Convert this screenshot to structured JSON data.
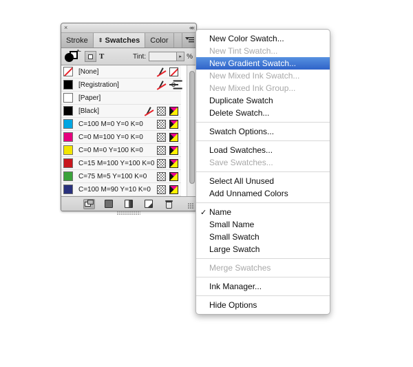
{
  "panel": {
    "close_icon": "×",
    "collapse_icon": "««",
    "tabs": [
      {
        "label": "Stroke",
        "active": false
      },
      {
        "label": "Swatches",
        "active": true
      },
      {
        "label": "Color",
        "active": false
      }
    ],
    "menu_button_icon": "panel-menu-icon",
    "toolbar": {
      "fill_stroke_proxy": "fill-stroke-proxy",
      "formatting_container_icon": "formatting-affects-container-icon",
      "formatting_text_icon": "T",
      "tint_label": "Tint:",
      "tint_value": "",
      "tint_placeholder": "",
      "tint_unit": "%",
      "stepper_icon": "▸"
    },
    "swatches": [
      {
        "name": "[None]",
        "chip": "none",
        "chip_color": "#ffffff",
        "icons": [
          "pen",
          "none-swatch"
        ]
      },
      {
        "name": "[Registration]",
        "chip": "solid",
        "chip_color": "#000000",
        "icons": [
          "pen",
          "registration"
        ]
      },
      {
        "name": "[Paper]",
        "chip": "solid",
        "chip_color": "#ffffff",
        "icons": []
      },
      {
        "name": "[Black]",
        "chip": "solid",
        "chip_color": "#000000",
        "icons": [
          "pen",
          "checkerboard",
          "cmyk"
        ]
      },
      {
        "name": "C=100 M=0 Y=0 K=0",
        "chip": "solid",
        "chip_color": "#00a6e2",
        "icons": [
          "checkerboard",
          "cmyk"
        ]
      },
      {
        "name": "C=0 M=100 Y=0 K=0",
        "chip": "solid",
        "chip_color": "#e5007e",
        "icons": [
          "checkerboard",
          "cmyk"
        ]
      },
      {
        "name": "C=0 M=0 Y=100 K=0",
        "chip": "solid",
        "chip_color": "#f3e500",
        "icons": [
          "checkerboard",
          "cmyk"
        ]
      },
      {
        "name": "C=15 M=100 Y=100 K=0",
        "chip": "solid",
        "chip_color": "#c8161d",
        "icons": [
          "checkerboard",
          "cmyk"
        ]
      },
      {
        "name": "C=75 M=5 Y=100 K=0",
        "chip": "solid",
        "chip_color": "#3aa23a",
        "icons": [
          "checkerboard",
          "cmyk"
        ]
      },
      {
        "name": "C=100 M=90 Y=10 K=0",
        "chip": "solid",
        "chip_color": "#29317d",
        "icons": [
          "checkerboard",
          "cmyk"
        ]
      }
    ],
    "footer_buttons": [
      {
        "name": "new-color-group-button",
        "icon": "new-color-group-icon",
        "pressed": true
      },
      {
        "name": "show-all-swatches-button",
        "icon": "solid-swatch-icon",
        "pressed": false
      },
      {
        "name": "show-gradient-swatches-button",
        "icon": "gradient-swatch-icon",
        "pressed": false
      },
      {
        "name": "new-swatch-button",
        "icon": "new-swatch-icon",
        "pressed": false
      },
      {
        "name": "delete-swatch-button",
        "icon": "trash-icon",
        "pressed": false
      }
    ]
  },
  "context_menu": {
    "items": [
      {
        "label": "New Color Swatch...",
        "state": "normal",
        "checked": false
      },
      {
        "label": "New Tint Swatch...",
        "state": "disabled",
        "checked": false
      },
      {
        "label": "New Gradient Swatch...",
        "state": "selected",
        "checked": false
      },
      {
        "label": "New Mixed Ink Swatch...",
        "state": "disabled",
        "checked": false
      },
      {
        "label": "New Mixed Ink Group...",
        "state": "disabled",
        "checked": false
      },
      {
        "label": "Duplicate Swatch",
        "state": "normal",
        "checked": false
      },
      {
        "label": "Delete Swatch...",
        "state": "normal",
        "checked": false
      },
      {
        "separator": true
      },
      {
        "label": "Swatch Options...",
        "state": "normal",
        "checked": false
      },
      {
        "separator": true
      },
      {
        "label": "Load Swatches...",
        "state": "normal",
        "checked": false
      },
      {
        "label": "Save Swatches...",
        "state": "disabled",
        "checked": false
      },
      {
        "separator": true
      },
      {
        "label": "Select All Unused",
        "state": "normal",
        "checked": false
      },
      {
        "label": "Add Unnamed Colors",
        "state": "normal",
        "checked": false
      },
      {
        "separator": true
      },
      {
        "label": "Name",
        "state": "normal",
        "checked": true
      },
      {
        "label": "Small Name",
        "state": "normal",
        "checked": false
      },
      {
        "label": "Small Swatch",
        "state": "normal",
        "checked": false
      },
      {
        "label": "Large Swatch",
        "state": "normal",
        "checked": false
      },
      {
        "separator": true
      },
      {
        "label": "Merge Swatches",
        "state": "disabled",
        "checked": false
      },
      {
        "separator": true
      },
      {
        "label": "Ink Manager...",
        "state": "normal",
        "checked": false
      },
      {
        "separator": true
      },
      {
        "label": "Hide Options",
        "state": "normal",
        "checked": false
      }
    ],
    "check_glyph": "✓"
  },
  "colors": {
    "highlight_top": "#5791e0",
    "highlight_bottom": "#2f63c9",
    "panel_bg": "#d9d9d9",
    "menu_bg": "#ffffff",
    "disabled_text": "#a8a8a8"
  }
}
